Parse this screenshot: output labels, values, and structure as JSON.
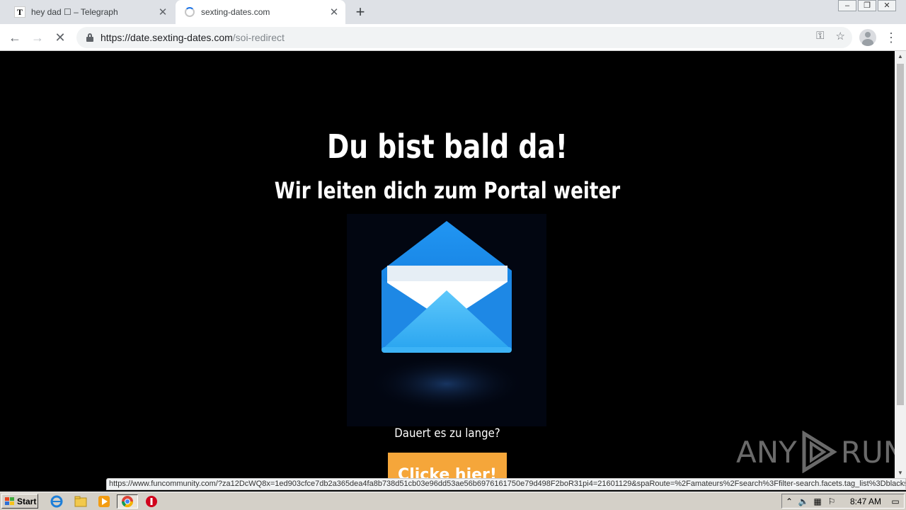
{
  "browser": {
    "tabs": [
      {
        "title": "hey dad ☐ – Telegraph",
        "favicon": "T",
        "active": false
      },
      {
        "title": "sexting-dates.com",
        "active": true
      }
    ],
    "new_tab_label": "+",
    "close_symbol": "✕",
    "url_host": "https://date.sexting-dates.com",
    "url_path": "/soi-redirect",
    "status_url": "https://www.funcommunity.com/?za12DcWQ8x=1ed903cfce7db2a365dea4fa8b738d51cb03e96dd53ae56b6976161750e79d498F2boR31pi4=21601129&spaRoute=%2Famateurs%2Fsearch%3Ffilter-search.facets.tag_list%3Dblacks"
  },
  "page": {
    "heading": "Du bist bald da!",
    "subheading": "Wir leiten dich zum Portal weiter",
    "too_long_text": "Dauert es zu lange?",
    "cta_label": "Clicke hier!",
    "watermark_left": "ANY",
    "watermark_right": "RUN"
  },
  "taskbar": {
    "start_label": "Start",
    "clock": "8:47 AM"
  },
  "colors": {
    "cta": "#f5a63a",
    "envelope_blue": "#1e88e5",
    "page_bg": "#000000"
  }
}
